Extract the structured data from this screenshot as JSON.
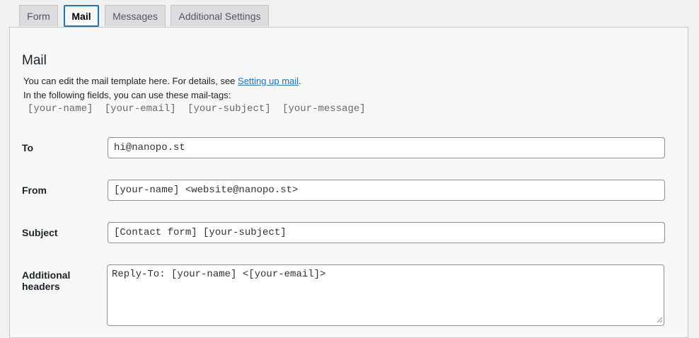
{
  "tabs": [
    {
      "label": "Form",
      "active": false
    },
    {
      "label": "Mail",
      "active": true
    },
    {
      "label": "Messages",
      "active": false
    },
    {
      "label": "Additional Settings",
      "active": false
    }
  ],
  "panel": {
    "title": "Mail",
    "desc_line1_prefix": "You can edit the mail template here. For details, see ",
    "desc_link": "Setting up mail",
    "desc_line1_suffix": ".",
    "desc_line2": "In the following fields, you can use these mail-tags:",
    "mail_tags": [
      "[your-name]",
      "[your-email]",
      "[your-subject]",
      "[your-message]"
    ]
  },
  "fields": {
    "to": {
      "label": "To",
      "value": "hi@nanopo.st"
    },
    "from": {
      "label": "From",
      "value": "[your-name] <website@nanopo.st>"
    },
    "subject": {
      "label": "Subject",
      "value": "[Contact form] [your-subject]"
    },
    "additional_headers": {
      "label_line1": "Additional",
      "label_line2": "headers",
      "value": "Reply-To: [your-name] <[your-email]>"
    }
  }
}
